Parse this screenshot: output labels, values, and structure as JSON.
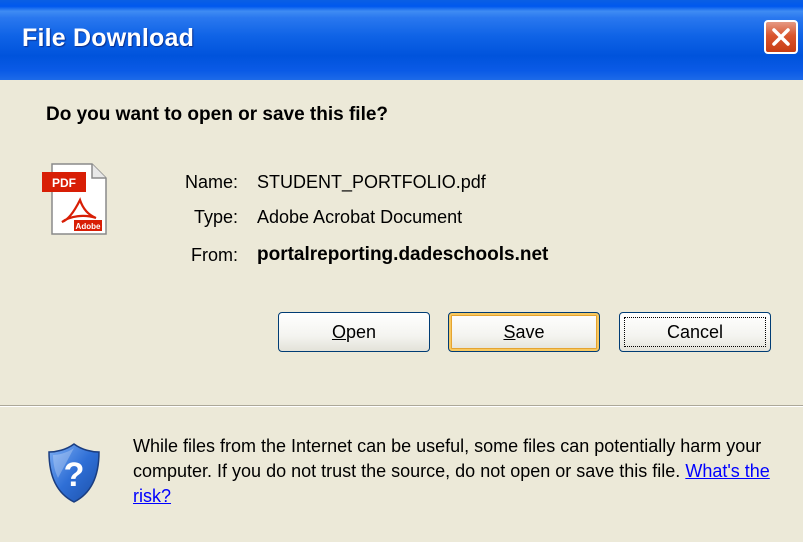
{
  "window": {
    "title": "File Download",
    "question": "Do you want to open or save this file?"
  },
  "file": {
    "name_label": "Name:",
    "name_value": "STUDENT_PORTFOLIO.pdf",
    "type_label": "Type:",
    "type_value": "Adobe Acrobat Document",
    "from_label": "From:",
    "from_value": "portalreporting.dadeschools.net",
    "icon_badge": "PDF",
    "icon_brand": "Adobe"
  },
  "buttons": {
    "open_mnemonic": "O",
    "open_rest": "pen",
    "save_mnemonic": "S",
    "save_rest": "ave",
    "cancel_label": "Cancel"
  },
  "warning": {
    "text": "While files from the Internet can be useful, some files can potentially harm your computer. If you do not trust the source, do not open or save this file. ",
    "link_text": "What's the risk?"
  },
  "icons": {
    "file_icon": "pdf-file-icon",
    "warning_icon": "shield-question-icon",
    "close_icon": "close-icon"
  },
  "colors": {
    "titlebar": "#0058ee",
    "dialog_bg": "#ece9d8",
    "close_button": "#d9552e",
    "link": "#0000ff",
    "default_button_highlight": "#f7c860"
  }
}
